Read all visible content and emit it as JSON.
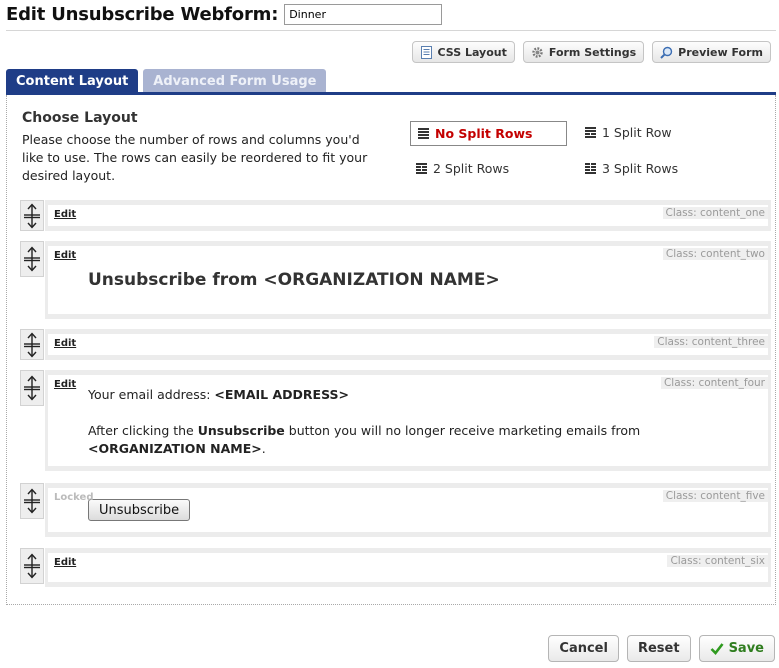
{
  "header": {
    "title": "Edit Unsubscribe Webform:",
    "form_name": "Dinner"
  },
  "toolbar": {
    "css_layout": "CSS Layout",
    "form_settings": "Form Settings",
    "preview_form": "Preview Form"
  },
  "tabs": [
    {
      "label": "Content Layout",
      "active": true
    },
    {
      "label": "Advanced Form Usage",
      "active": false
    }
  ],
  "choose_layout": {
    "title": "Choose Layout",
    "description": "Please choose the number of rows and columns you'd like to use. The rows can easily be reordered to fit your desired layout.",
    "options": [
      {
        "label": "No Split Rows",
        "selected": true
      },
      {
        "label": "1 Split Row",
        "selected": false
      },
      {
        "label": "2 Split Rows",
        "selected": false
      },
      {
        "label": "3 Split Rows",
        "selected": false
      }
    ]
  },
  "rows": [
    {
      "edit_label": "Edit",
      "class_label": "Class: content_one"
    },
    {
      "edit_label": "Edit",
      "class_label": "Class: content_two",
      "heading": "Unsubscribe from <ORGANIZATION NAME>"
    },
    {
      "edit_label": "Edit",
      "class_label": "Class: content_three"
    },
    {
      "edit_label": "Edit",
      "class_label": "Class: content_four",
      "email_prefix": "Your email address: ",
      "email_token": "<EMAIL ADDRESS>",
      "after_prefix": "After clicking the ",
      "after_bold": "Unsubscribe",
      "after_suffix": " button you will no longer receive marketing emails from",
      "org_token": "<ORGANIZATION NAME>",
      "org_suffix": "."
    },
    {
      "edit_label": "Locked",
      "class_label": "Class: content_five",
      "button_label": "Unsubscribe"
    },
    {
      "edit_label": "Edit",
      "class_label": "Class: content_six"
    }
  ],
  "footer": {
    "cancel": "Cancel",
    "reset": "Reset",
    "save": "Save"
  },
  "colors": {
    "tab_active": "#1f3d87",
    "tab_inactive": "#a9b3d1",
    "selected_option": "#c40000",
    "save_check": "#2f9a1f"
  }
}
